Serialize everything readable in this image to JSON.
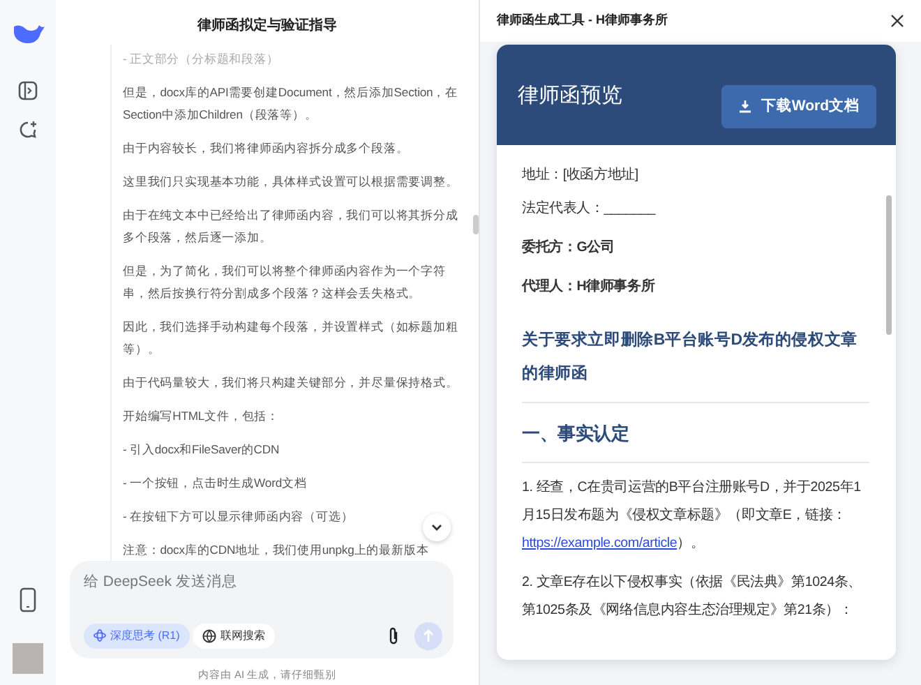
{
  "chat": {
    "title": "律师函拟定与验证指导",
    "messages": [
      {
        "text": "- 正文部分（分标题和段落）",
        "faded": true
      },
      {
        "text": "但是，docx库的API需要创建Document，然后添加Section，在Section中添加Children（段落等）。",
        "faded": false
      },
      {
        "text": "由于内容较长，我们将律师函内容拆分成多个段落。",
        "faded": false
      },
      {
        "text": "这里我们只实现基本功能，具体样式设置可以根据需要调整。",
        "faded": false
      },
      {
        "text": "由于在纯文本中已经给出了律师函内容，我们可以将其拆分成多个段落，然后逐一添加。",
        "faded": false
      },
      {
        "text": "但是，为了简化，我们可以将整个律师函内容作为一个字符串，然后按换行符分割成多个段落？这样会丢失格式。",
        "faded": false
      },
      {
        "text": "因此，我们选择手动构建每个段落，并设置样式（如标题加粗等）。",
        "faded": false
      },
      {
        "text": "由于代码量较大，我们将只构建关键部分，并尽量保持格式。",
        "faded": false
      },
      {
        "text": "开始编写HTML文件，包括：",
        "faded": false
      },
      {
        "text": "- 引入docx和FileSaver的CDN",
        "faded": false
      },
      {
        "text": "- 一个按钮，点击时生成Word文档",
        "faded": false
      },
      {
        "text": "- 在按钮下方可以显示律师函内容（可选）",
        "faded": false
      },
      {
        "text": "注意：docx库的CDN地址，我们使用unpkg上的最新版本",
        "faded": false
      }
    ],
    "input": {
      "placeholder": "给 DeepSeek 发送消息"
    },
    "toggles": [
      {
        "label": "深度思考 (R1)",
        "selected": true
      },
      {
        "label": "联网搜索",
        "selected": false
      }
    ],
    "footer": "内容由 AI 生成，请仔细甄别"
  },
  "panel": {
    "title": "律师函生成工具 - H律师事务所",
    "card_title": "律师函预览",
    "download_button": "下载Word文档",
    "items": [
      {
        "kind": "field",
        "text": "地址：[收函方地址]"
      },
      {
        "kind": "field",
        "text": "法定代表人：_______"
      },
      {
        "kind": "party",
        "text": "委托方：G公司"
      },
      {
        "kind": "party",
        "text": "代理人：H律师事务所"
      },
      {
        "kind": "title",
        "text": "关于要求立即删除B平台账号D发布的侵权文章的律师函"
      },
      {
        "kind": "section",
        "text": "一、事实认定"
      },
      {
        "kind": "para",
        "text": "1. 经查，C在贵司运营的B平台注册账号D，并于2025年1月15日发布题为《侵权文章标题》（即文章E，链接：",
        "link": "https://example.com/article",
        "after": "）。"
      },
      {
        "kind": "para",
        "text": "2. 文章E存在以下侵权事实（依据《民法典》第1024条、第1025条及《网络信息内容生态治理规定》第21条）："
      }
    ]
  }
}
